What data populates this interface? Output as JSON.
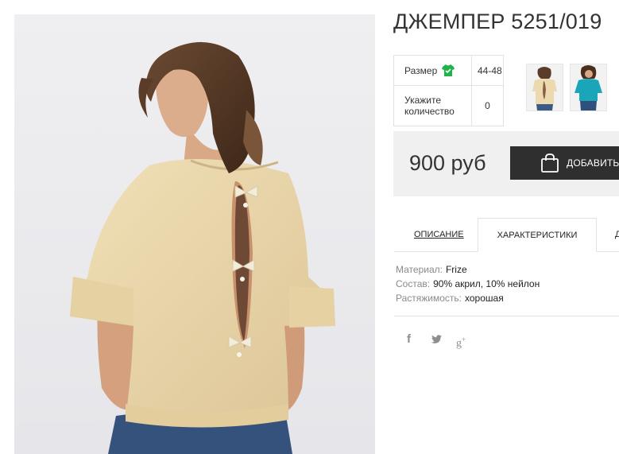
{
  "product": {
    "title": "ДЖЕМПЕР 5251/019"
  },
  "options": {
    "size_label": "Размер",
    "size_value": "44-48",
    "quantity_label": "Укажите количество",
    "quantity_value": "0"
  },
  "buy": {
    "price": "900 руб",
    "add_label": "ДОБАВИТЬ"
  },
  "tabs": [
    {
      "label": "ОПИСАНИЕ",
      "active": false
    },
    {
      "label": "ХАРАКТЕРИСТИКИ",
      "active": true
    },
    {
      "label": "Д",
      "active": false
    }
  ],
  "specs": [
    {
      "key": "Материал:",
      "value": "Frize"
    },
    {
      "key": "Состав:",
      "value": "90% акрил, 10% нейлон"
    },
    {
      "key": "Растяжимость:",
      "value": "хорошая"
    }
  ],
  "social": [
    {
      "icon": "facebook-icon",
      "glyph": "f"
    },
    {
      "icon": "twitter-icon",
      "glyph": "t"
    },
    {
      "icon": "google-plus-icon",
      "glyph": "g+"
    }
  ],
  "colors": {
    "size_icon": "#1fb34a",
    "sweater": "#ecd9ae",
    "button": "#2f2f2f",
    "thumb2_top": "#1aa5b8"
  }
}
